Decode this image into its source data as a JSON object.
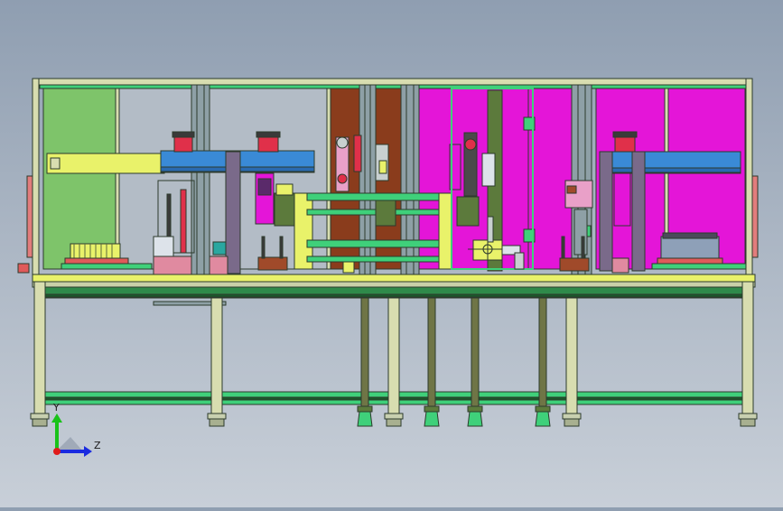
{
  "viewport": {
    "triad": {
      "axis_y_label": "Y",
      "axis_z_label": "Z",
      "axis_y_color": "#19c219",
      "axis_z_color": "#1a2be0",
      "axis_x_color": "#e01b1b"
    }
  },
  "colors": {
    "background_top": "#8f9eb1",
    "background_bottom": "#c8cfd8",
    "frame_profile": "#d8ddb0",
    "frame_edge": "#2c3a2c",
    "panel_green": "#7ec46a",
    "panel_brown": "#8a3c1c",
    "panel_magenta": "#e415d8",
    "rail_green": "#3fd07a",
    "beam_yellow": "#e9f26a",
    "gantry_blue": "#3a8ad6",
    "cylinder_red": "#e0304a",
    "motor_olive": "#5c7a3c",
    "column_grey": "#8ea0a6",
    "leg_olive": "#6f7546"
  }
}
